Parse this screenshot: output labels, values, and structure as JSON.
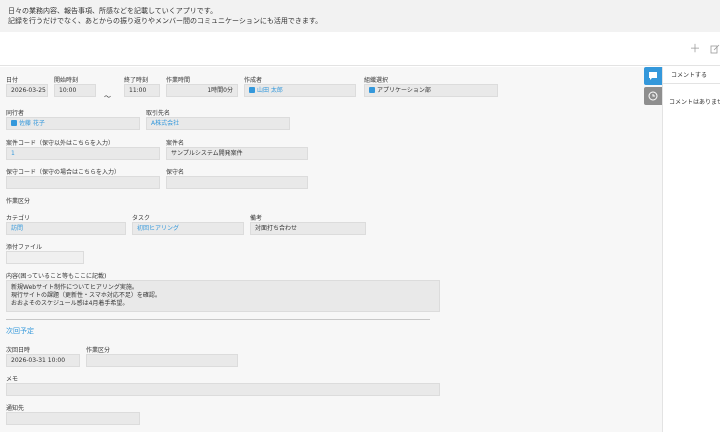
{
  "app_description": {
    "line1": "日々の業務内容、報告事項、所感などを記載していくアプリです。",
    "line2": "記録を行うだけでなく、あとからの振り返りやメンバー間のコミュニケーションにも活用できます。"
  },
  "toolbar": {
    "add_icon": "plus-icon",
    "edit_icon": "edit-icon"
  },
  "record": {
    "date": {
      "label": "日付",
      "value": "2026-03-25"
    },
    "start_time": {
      "label": "開始時刻",
      "value": "10:00"
    },
    "tilde": "～",
    "end_time": {
      "label": "終了時刻",
      "value": "11:00"
    },
    "work_hours": {
      "label": "作業時間",
      "value": "1時間0分"
    },
    "creator": {
      "label": "作成者",
      "value": "山田 太郎"
    },
    "org": {
      "label": "組織選択",
      "value": "アプリケーション部"
    },
    "companion": {
      "label": "同行者",
      "value": "佐藤 花子"
    },
    "client": {
      "label": "取引先名",
      "value": "A株式会社"
    },
    "case_code": {
      "label": "案件コード（保守以外はこちらを入力）",
      "value": "1"
    },
    "case_name": {
      "label": "案件名",
      "value": "サンプルシステム開発案件"
    },
    "maint_code": {
      "label": "保守コード（保守の場合はこちらを入力）",
      "value": ""
    },
    "maint_name": {
      "label": "保守名",
      "value": ""
    },
    "work_section": {
      "label": "作業区分"
    },
    "category": {
      "label": "カテゴリ",
      "value": "訪問"
    },
    "task": {
      "label": "タスク",
      "value": "初回ヒアリング"
    },
    "note": {
      "label": "備考",
      "value": "対面打ち合わせ"
    },
    "attachment": {
      "label": "添付ファイル"
    },
    "content": {
      "label": "内容(困っていること等もここに記載)",
      "value": "新規Webサイト制作についてヒアリング実施。\n現行サイトの課題（更新性・スマホ対応不足）を確認。\nおおよそのスケジュール感は4月着手希望。"
    }
  },
  "next_plan": {
    "title": "次回予定",
    "next_datetime": {
      "label": "次回日時",
      "value": "2026-03-31 10:00"
    },
    "work_category": {
      "label": "作業区分",
      "value": ""
    },
    "memo": {
      "label": "メモ",
      "value": ""
    },
    "notify": {
      "label": "通知先",
      "value": ""
    }
  },
  "side": {
    "comment_tab_icon": "comment-icon",
    "history_tab_icon": "history-icon",
    "comment_header": "コメントする",
    "no_comment": "コメントはありませ"
  },
  "colors": {
    "accent": "#3498db",
    "side_tab_active": "#3498db",
    "side_tab_inactive": "#8e8e8e"
  }
}
